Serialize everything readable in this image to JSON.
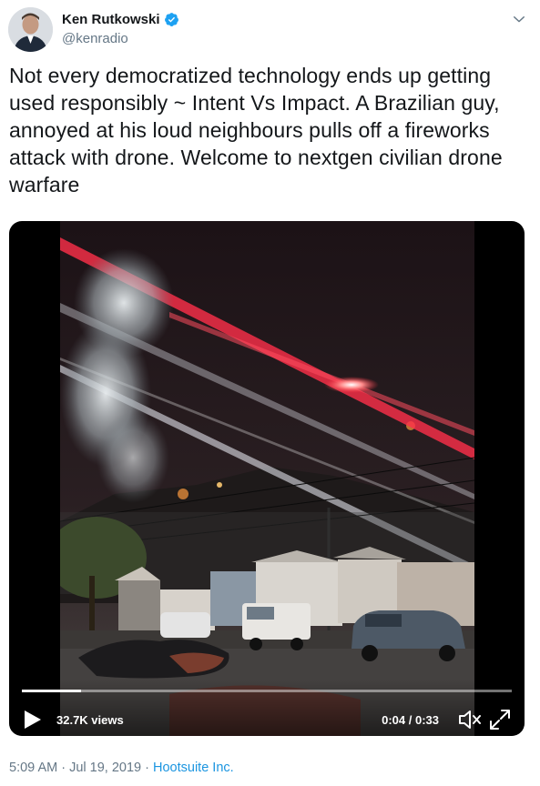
{
  "author": {
    "display_name": "Ken Rutkowski",
    "handle": "@kenradio",
    "verified_icon": "verified-badge-icon",
    "avatar_icon": "avatar"
  },
  "tweet": {
    "text": "Not every democratized technology ends up getting used responsibly ~ Intent Vs Impact. A Brazilian guy, annoyed at his loud neighbours pulls off a fireworks attack with drone. Welcome to nextgen civilian drone warfare"
  },
  "video": {
    "views": "32.7K views",
    "time": "0:04 / 0:33",
    "progress": 0.12,
    "icons": [
      "play-icon",
      "mute-icon",
      "fullscreen-icon"
    ]
  },
  "meta": {
    "time": "5:09 AM",
    "separator": " · ",
    "date": "Jul 19, 2019",
    "source": "Hootsuite Inc."
  },
  "colors": {
    "brand_blue": "#1da1f2",
    "link_blue": "#1b95e0",
    "secondary_text": "#657786",
    "primary_text": "#14171a"
  }
}
